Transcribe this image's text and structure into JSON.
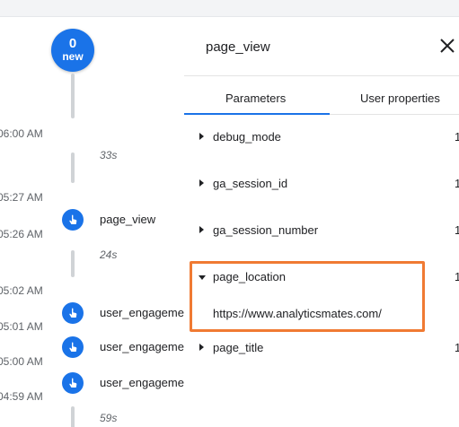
{
  "timeline": {
    "new_badge": {
      "count": "0",
      "label": "new"
    },
    "times": [
      "06:00 AM",
      "05:27 AM",
      "05:26 AM",
      "05:02 AM",
      "05:01 AM",
      "05:00 AM",
      "04:59 AM"
    ],
    "gaps": [
      "33s",
      "24s",
      "59s"
    ],
    "events": [
      "page_view",
      "user_engagement",
      "user_engagement",
      "user_engagement"
    ]
  },
  "panel": {
    "title": "page_view",
    "tabs": [
      "Parameters",
      "User properties"
    ],
    "params": [
      {
        "name": "debug_mode",
        "count": "1"
      },
      {
        "name": "ga_session_id",
        "count": "1"
      },
      {
        "name": "ga_session_number",
        "count": "1"
      },
      {
        "name": "page_location",
        "count": "1",
        "value": "https://www.analyticsmates.com/"
      },
      {
        "name": "page_title",
        "count": "1"
      }
    ]
  },
  "colors": {
    "accent": "#1a73e8",
    "highlight": "#f07a33"
  },
  "icons": {
    "event": "touch-icon",
    "close": "close-icon",
    "expand": "caret-right-icon",
    "collapse": "caret-down-icon"
  }
}
